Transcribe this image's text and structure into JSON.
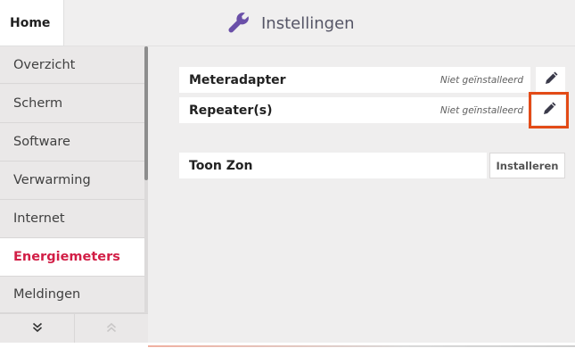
{
  "header": {
    "home_label": "Home",
    "title": "Instellingen",
    "icon": "wrench-icon"
  },
  "sidebar": {
    "items": [
      {
        "label": "Overzicht"
      },
      {
        "label": "Scherm"
      },
      {
        "label": "Software"
      },
      {
        "label": "Verwarming"
      },
      {
        "label": "Internet"
      },
      {
        "label": "Energiemeters",
        "active": true
      },
      {
        "label": "Meldingen"
      }
    ],
    "nav_down_icon": "chevron-double-down-icon",
    "nav_up_icon": "chevron-double-up-icon"
  },
  "main": {
    "rows": [
      {
        "label": "Meteradapter",
        "status": "Niet geïnstalleerd",
        "action_icon": "pencil-icon"
      },
      {
        "label": "Repeater(s)",
        "status": "Niet geïnstalleerd",
        "action_icon": "pencil-icon"
      },
      {
        "label": "Toon Zon",
        "button_label": "Installeren"
      }
    ]
  },
  "colors": {
    "accent_active": "#d21e46",
    "highlight_outline": "#e34b17",
    "header_text": "#555566"
  }
}
